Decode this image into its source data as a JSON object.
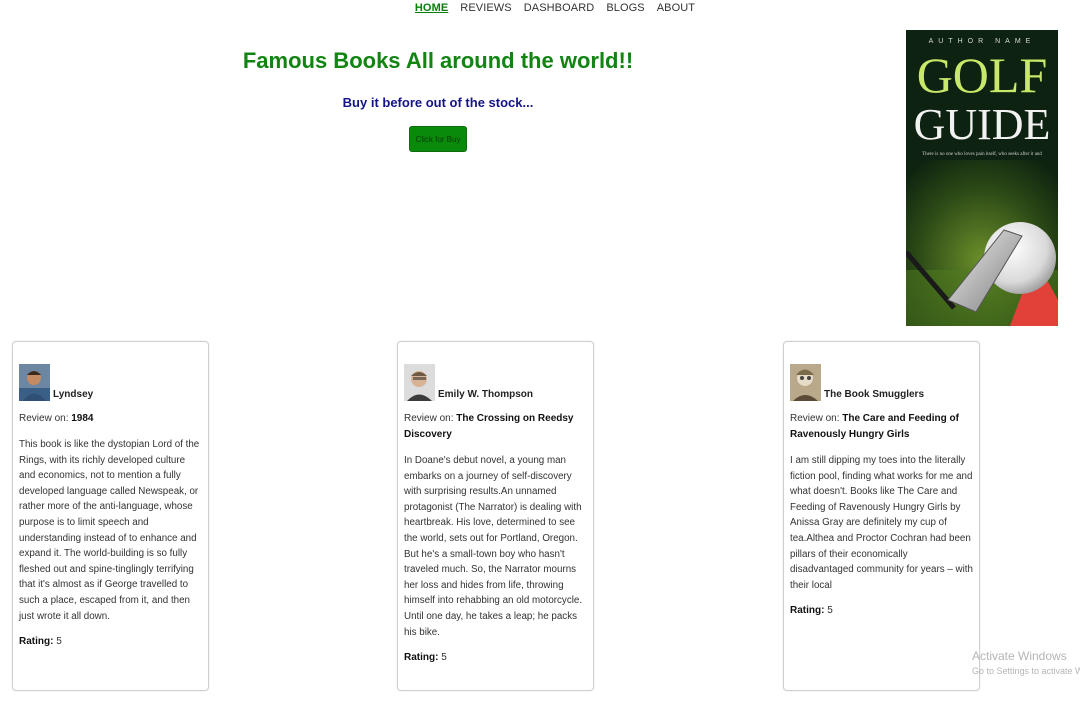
{
  "nav": {
    "items": [
      {
        "label": "HOME"
      },
      {
        "label": "REVIEWS"
      },
      {
        "label": "DASHBOARD"
      },
      {
        "label": "BLOGS"
      },
      {
        "label": "ABOUT"
      }
    ]
  },
  "hero": {
    "title": "Famous Books All around the world!!",
    "subtitle": "Buy it before out of the stock...",
    "button_label": "Click for Buy"
  },
  "cover": {
    "author": "AUTHOR NAME",
    "title_line1": "GOLF",
    "title_line2": "GUIDE",
    "tagline": "There is no one who loves pain itself, who seeks after it and"
  },
  "reviews": [
    {
      "reviewer": "Lyndsey",
      "review_on_prefix": "Review on:",
      "book": "1984",
      "text": "This book is like the dystopian Lord of the Rings, with its richly developed culture and economics, not to mention a fully developed language called Newspeak, or rather more of the anti-language, whose purpose is to limit speech and understanding instead of to enhance and expand it. The world-building is so fully fleshed out and spine-tinglingly terrifying that it's almost as if George travelled to such a place, escaped from it, and then just wrote it all down.",
      "rating_label": "Rating:",
      "rating": "5"
    },
    {
      "reviewer": "Emily W. Thompson",
      "review_on_prefix": "Review on:",
      "book": "The Crossing on Reedsy Discovery",
      "text": "In Doane's debut novel, a young man embarks on a journey of self-discovery with surprising results.An unnamed protagonist (The Narrator) is dealing with heartbreak. His love, determined to see the world, sets out for Portland, Oregon. But he's a small-town boy who hasn't traveled much. So, the Narrator mourns her loss and hides from life, throwing himself into rehabbing an old motorcycle. Until one day, he takes a leap; he packs his bike.",
      "rating_label": "Rating:",
      "rating": "5"
    },
    {
      "reviewer": "The Book Smugglers",
      "review_on_prefix": "Review on:",
      "book": "The Care and Feeding of Ravenously Hungry Girls",
      "text": "I am still dipping my toes into the literally fiction pool, finding what works for me and what doesn't. Books like The Care and Feeding of Ravenously Hungry Girls by Anissa Gray are definitely my cup of tea.Althea and Proctor Cochran had been pillars of their economically disadvantaged community for years – with their local",
      "rating_label": "Rating:",
      "rating": "5"
    }
  ],
  "watermark": {
    "line1": "Activate Windows",
    "line2": "Go to Settings to activate Windows."
  },
  "colors": {
    "title_green": "#118411",
    "subtitle_navy": "#151588",
    "button_green": "#0a8a0a",
    "nav_active": "#0b7d0b"
  }
}
